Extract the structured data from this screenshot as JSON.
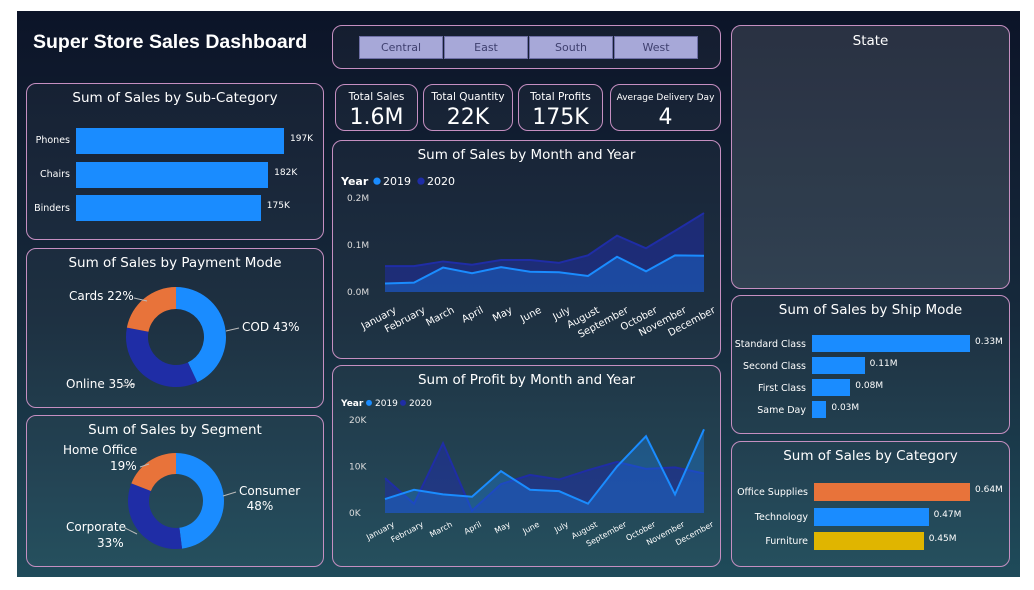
{
  "title": "Super Store Sales Dashboard",
  "slicer": [
    "Central",
    "East",
    "South",
    "West"
  ],
  "kpis": [
    {
      "label": "Total Sales",
      "value": "1.6M"
    },
    {
      "label": "Total Quantity",
      "value": "22K"
    },
    {
      "label": "Total Profits",
      "value": "175K"
    },
    {
      "label": "Average Delivery Day",
      "value": "4"
    }
  ],
  "state_title": "State",
  "colors": {
    "blue": "#1a8cff",
    "navy": "#1f2da6",
    "orange": "#e8733a",
    "gold": "#e0b500"
  },
  "chart_data": [
    {
      "type": "bar",
      "title": "Sum of Sales by Sub-Category",
      "categories": [
        "Phones",
        "Chairs",
        "Binders"
      ],
      "values": [
        197,
        182,
        175
      ],
      "value_labels": [
        "197K",
        "182K",
        "175K"
      ]
    },
    {
      "type": "pie",
      "title": "Sum of Sales by Payment Mode",
      "categories": [
        "COD",
        "Online",
        "Cards"
      ],
      "values": [
        43,
        35,
        22
      ],
      "labels": [
        "COD 43%",
        "Online 35%",
        "Cards 22%"
      ],
      "colors": [
        "#1a8cff",
        "#1f2da6",
        "#e8733a"
      ]
    },
    {
      "type": "pie",
      "title": "Sum of Sales by Segment",
      "categories": [
        "Consumer",
        "Corporate",
        "Home Office"
      ],
      "values": [
        48,
        33,
        19
      ],
      "labels": [
        "Consumer",
        "Corporate",
        "Home Office"
      ],
      "pcts": [
        "48%",
        "33%",
        "19%"
      ],
      "colors": [
        "#1a8cff",
        "#1f2da6",
        "#e8733a"
      ]
    },
    {
      "type": "area",
      "title": "Sum of Sales by Month and Year",
      "legend_title": "Year",
      "categories": [
        "January",
        "February",
        "March",
        "April",
        "May",
        "June",
        "July",
        "August",
        "September",
        "October",
        "November",
        "December"
      ],
      "series": [
        {
          "name": "2019",
          "values": [
            0.018,
            0.02,
            0.052,
            0.04,
            0.053,
            0.043,
            0.042,
            0.034,
            0.075,
            0.044,
            0.078,
            0.077
          ]
        },
        {
          "name": "2020",
          "values": [
            0.055,
            0.055,
            0.065,
            0.058,
            0.068,
            0.068,
            0.062,
            0.078,
            0.12,
            0.093,
            0.13,
            0.168
          ]
        }
      ],
      "ylim": [
        0,
        0.2
      ],
      "yticks": [
        0,
        0.1,
        0.2
      ],
      "ytick_labels": [
        "0.0M",
        "0.1M",
        "0.2M"
      ]
    },
    {
      "type": "area",
      "title": "Sum of Profit by Month and Year",
      "legend_title": "Year",
      "categories": [
        "January",
        "February",
        "March",
        "April",
        "May",
        "June",
        "July",
        "August",
        "September",
        "October",
        "November",
        "December"
      ],
      "series": [
        {
          "name": "2019",
          "values": [
            3000,
            5000,
            4000,
            3500,
            9000,
            5000,
            4700,
            2000,
            10000,
            16500,
            4000,
            18000
          ]
        },
        {
          "name": "2020",
          "values": [
            7500,
            2000,
            15000,
            500,
            6200,
            8200,
            7200,
            9200,
            11000,
            9500,
            9800,
            8500
          ]
        }
      ],
      "ylim": [
        0,
        20000
      ],
      "yticks": [
        0,
        10000,
        20000
      ],
      "ytick_labels": [
        "0K",
        "10K",
        "20K"
      ]
    },
    {
      "type": "bar",
      "title": "Sum of Sales by Ship Mode",
      "categories": [
        "Standard Class",
        "Second Class",
        "First Class",
        "Same Day"
      ],
      "values": [
        0.33,
        0.11,
        0.08,
        0.03
      ],
      "value_labels": [
        "0.33M",
        "0.11M",
        "0.08M",
        "0.03M"
      ]
    },
    {
      "type": "bar",
      "title": "Sum of Sales by Category",
      "categories": [
        "Office Supplies",
        "Technology",
        "Furniture"
      ],
      "values": [
        0.64,
        0.47,
        0.45
      ],
      "value_labels": [
        "0.64M",
        "0.47M",
        "0.45M"
      ],
      "colors": [
        "#e8733a",
        "#1a8cff",
        "#e0b500"
      ]
    }
  ]
}
